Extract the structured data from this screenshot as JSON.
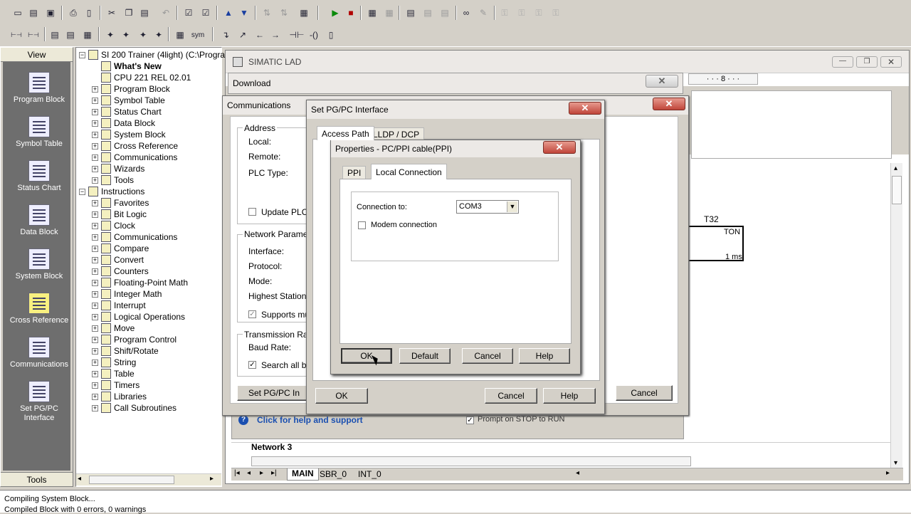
{
  "nav": {
    "header": "View",
    "footer": "Tools",
    "items": [
      {
        "label": "Program Block",
        "icon": "program-block-icon"
      },
      {
        "label": "Symbol Table",
        "icon": "symbol-table-icon"
      },
      {
        "label": "Status Chart",
        "icon": "status-chart-icon"
      },
      {
        "label": "Data Block",
        "icon": "data-block-icon"
      },
      {
        "label": "System Block",
        "icon": "system-block-icon"
      },
      {
        "label": "Cross Reference",
        "icon": "cross-reference-icon"
      },
      {
        "label": "Communications",
        "icon": "communications-icon"
      },
      {
        "label": "Set PG/PC Interface",
        "icon": "set-pgpc-icon"
      }
    ]
  },
  "tree": {
    "root": "SI 200 Trainer (4light) (C:\\Program",
    "items": [
      {
        "label": "What's New",
        "bold": true
      },
      {
        "label": "CPU 221 REL 02.01"
      },
      {
        "label": "Program Block"
      },
      {
        "label": "Symbol Table"
      },
      {
        "label": "Status Chart"
      },
      {
        "label": "Data Block"
      },
      {
        "label": "System Block"
      },
      {
        "label": "Cross Reference"
      },
      {
        "label": "Communications"
      },
      {
        "label": "Wizards"
      },
      {
        "label": "Tools"
      },
      {
        "label": "Instructions"
      },
      {
        "label": "Favorites"
      },
      {
        "label": "Bit Logic"
      },
      {
        "label": "Clock"
      },
      {
        "label": "Communications"
      },
      {
        "label": "Compare"
      },
      {
        "label": "Convert"
      },
      {
        "label": "Counters"
      },
      {
        "label": "Floating-Point Math"
      },
      {
        "label": "Integer Math"
      },
      {
        "label": "Interrupt"
      },
      {
        "label": "Logical Operations"
      },
      {
        "label": "Move"
      },
      {
        "label": "Program Control"
      },
      {
        "label": "Shift/Rotate"
      },
      {
        "label": "String"
      },
      {
        "label": "Table"
      },
      {
        "label": "Timers"
      },
      {
        "label": "Libraries"
      },
      {
        "label": "Call Subroutines"
      }
    ]
  },
  "lad": {
    "title": "SIMATIC LAD",
    "ruler": "· · · 8 · · ·",
    "timer_name": "T32",
    "timer_type": "TON",
    "timer_base": "1 ms",
    "network3": "Network 3",
    "tabs": [
      "MAIN",
      "SBR_0",
      "INT_0"
    ],
    "help_link": "Click for help and support",
    "prompt_stop": "Prompt on STOP to RUN"
  },
  "download": {
    "title": "Download"
  },
  "communications": {
    "title": "Communications",
    "address_group": "Address",
    "local": "Local:",
    "remote": "Remote:",
    "plc_type": "PLC Type:",
    "update_plc": "Update PLC t",
    "network_group": "Network Paramete",
    "interface": "Interface:",
    "protocol": "Protocol:",
    "mode": "Mode:",
    "highest_station": "Highest Station (",
    "supports": "Supports mu",
    "transmission_group": "Transmission Rate",
    "baud_rate": "Baud Rate:",
    "search_all": "Search all ba",
    "set_pgpc_button": "Set PG/PC In",
    "cancel": "Cancel"
  },
  "pgpc": {
    "title": "Set PG/PC Interface",
    "tab_access": "Access Path",
    "tab_lldp": "LLDP / DCP",
    "ok": "OK",
    "cancel": "Cancel",
    "help": "Help"
  },
  "props": {
    "title": "Properties - PC/PPI cable(PPI)",
    "tab_ppi": "PPI",
    "tab_local": "Local Connection",
    "connection_label": "Connection to:",
    "connection_value": "COM3",
    "modem_label": "Modem connection",
    "ok": "OK",
    "default": "Default",
    "cancel": "Cancel",
    "help": "Help"
  },
  "status": {
    "line1": "Compiling System Block...",
    "line2": "Compiled Block with 0 errors, 0 warnings"
  },
  "colors": {
    "nav_bg": "#6e6e6e",
    "title_active": "#3a6ea5",
    "close_red": "#c0453a"
  }
}
